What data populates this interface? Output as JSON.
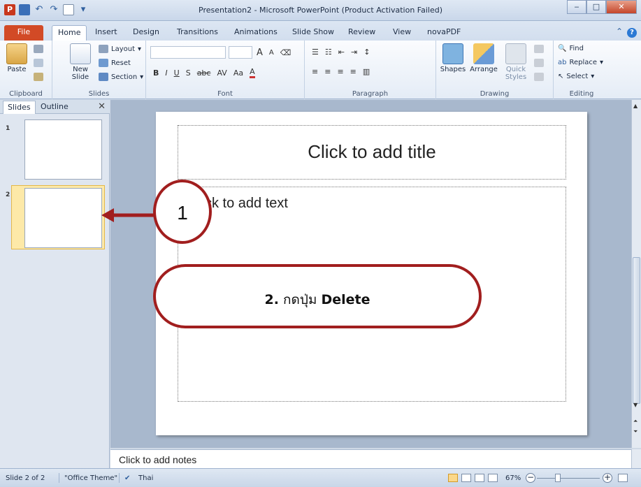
{
  "window": {
    "title": "Presentation2 - Microsoft PowerPoint (Product Activation Failed)",
    "app_logo": "P"
  },
  "ribbon_tabs": [
    "File",
    "Home",
    "Insert",
    "Design",
    "Transitions",
    "Animations",
    "Slide Show",
    "Review",
    "View",
    "novaPDF"
  ],
  "active_tab": "Home",
  "ribbon": {
    "clipboard": {
      "paste": "Paste",
      "label": "Clipboard"
    },
    "slides": {
      "new_slide": "New Slide",
      "layout": "Layout",
      "reset": "Reset",
      "section": "Section",
      "label": "Slides"
    },
    "font": {
      "label": "Font",
      "format_buttons": [
        "B",
        "I",
        "U",
        "S",
        "abc",
        "AV",
        "Aa",
        "A"
      ],
      "size_buttons": [
        "A",
        "A"
      ]
    },
    "paragraph": {
      "label": "Paragraph"
    },
    "drawing": {
      "shapes": "Shapes",
      "arrange": "Arrange",
      "quick_styles": "Quick Styles",
      "label": "Drawing"
    },
    "editing": {
      "find": "Find",
      "replace": "Replace",
      "select": "Select",
      "label": "Editing"
    }
  },
  "pane": {
    "tabs": [
      "Slides",
      "Outline"
    ],
    "active_tab": "Slides",
    "slides": [
      {
        "number": "1"
      },
      {
        "number": "2"
      }
    ],
    "selected_slide": 2
  },
  "slide": {
    "title_placeholder": "Click to add title",
    "body_placeholder": "ck to add text"
  },
  "notes": {
    "placeholder": "Click to add notes"
  },
  "statusbar": {
    "slide_info": "Slide 2 of 2",
    "theme": "\"Office Theme\"",
    "language": "Thai",
    "zoom": "67%"
  },
  "annotations": {
    "step1": "1",
    "step2_prefix": "2.",
    "step2_text": " กดปุ่ม ",
    "step2_key": "Delete",
    "color": "#a11e1e"
  },
  "colors": {
    "file_tab": "#d24a26",
    "selected_thumb": "#fde9a8"
  }
}
